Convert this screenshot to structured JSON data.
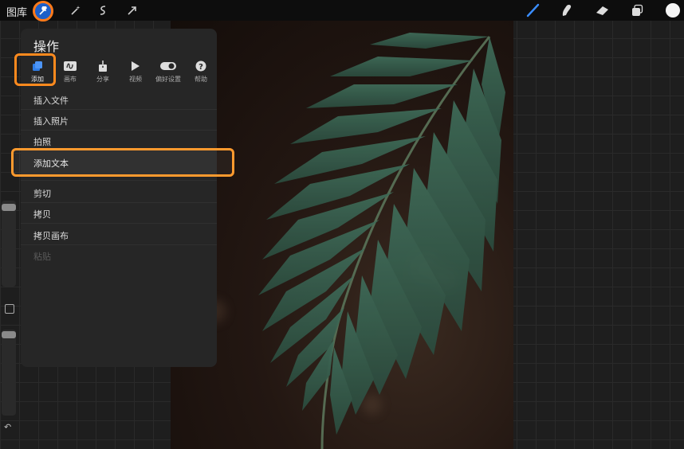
{
  "topbar": {
    "gallery_label": "图库",
    "icons": [
      "wrench-icon",
      "magic-wand-icon",
      "selection-icon",
      "transform-arrow-icon",
      "brush-icon",
      "smudge-icon",
      "eraser-icon",
      "layers-icon",
      "color-icon"
    ],
    "accent": "#ff7a1a"
  },
  "panel": {
    "title": "操作",
    "tabs": [
      {
        "label": "添加",
        "icon": "add-icon"
      },
      {
        "label": "画布",
        "icon": "canvas-icon"
      },
      {
        "label": "分享",
        "icon": "share-icon"
      },
      {
        "label": "视频",
        "icon": "video-play-icon"
      },
      {
        "label": "偏好设置",
        "icon": "toggle-icon"
      },
      {
        "label": "帮助",
        "icon": "help-icon"
      }
    ],
    "items": [
      "插入文件",
      "插入照片",
      "拍照",
      "添加文本",
      "剪切",
      "拷贝",
      "拷贝画布",
      "粘贴"
    ],
    "highlight_color": "#ff9a2e"
  }
}
